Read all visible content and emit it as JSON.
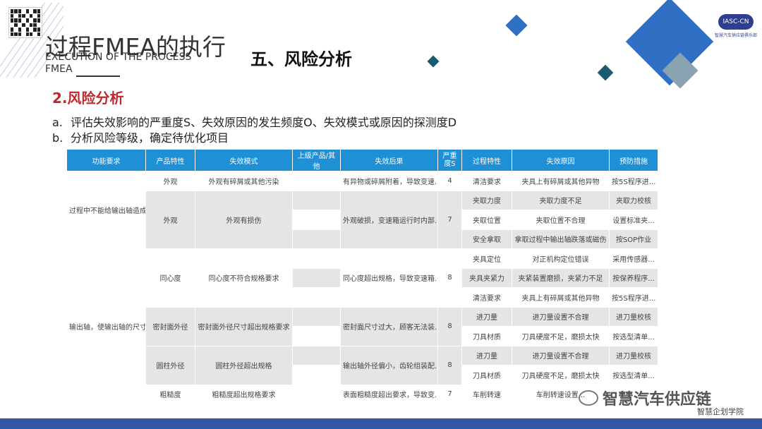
{
  "header": {
    "main_title": "过程FMEA的执行",
    "subtitle_en": "EXECUTION OF THE PROCESS FMEA",
    "section_title": "五、风险分析",
    "logo_text": "IASC-CN",
    "logo_sub": "智慧汽车供应链俱乐部"
  },
  "content": {
    "point_title": "2.风险分析",
    "items": [
      {
        "marker": "a.",
        "text": "评估失效影响的严重度S、失效原因的发生频度O、失效模式或原因的探测度D"
      },
      {
        "marker": "b.",
        "text": "分析风险等级，确定待优化项目"
      }
    ]
  },
  "table": {
    "headers": [
      "功能要求",
      "产品特性",
      "失效模式",
      "上级产品/其他",
      "失效后果",
      "严重度S",
      "过程特性",
      "失效原因",
      "预防措施"
    ],
    "function_groups": [
      "过程中不能给输出轴造成...",
      "输出轴，使输出轴的尺寸..."
    ],
    "characteristics": [
      "外观",
      "外观",
      "同心度",
      "密封面外径",
      "圆柱外径",
      "粗糙度"
    ],
    "failure_modes": [
      "外观有碎屑或其他污染",
      "外观有损伤",
      "同心度不符合规格要求",
      "密封面外径尺寸超出规格要求",
      "圆柱外径超出规格",
      "粗糙度超出规格要求"
    ],
    "effects": [
      "有异物或碎屑附着，导致变速...",
      "外观破损，变速箱运行时内部...",
      "同心度超出规格，导致变速箱...",
      "密封面尺寸过大，顾客无法装...",
      "输出轴外径偏小，齿轮组装配...",
      "表面粗糙度超出要求，导致变..."
    ],
    "severities": [
      "4",
      "7",
      "8",
      "8",
      "8",
      "7"
    ],
    "process_chars": [
      "清洁要求",
      "夹取力度",
      "夹取位置",
      "安全拿取",
      "夹具定位",
      "夹具夹紧力",
      "清洁要求",
      "进刀量",
      "刀具材质",
      "进刀量",
      "刀具材质",
      "车削转速"
    ],
    "causes": [
      "夹具上有碎屑或其他异物",
      "夹取力度不足",
      "夹取位置不合理",
      "拿取过程中输出轴跌落或磁伤",
      "对正机构定位错误",
      "夹紧装置磨损，夹紧力不足",
      "夹具上有碎屑或其他异物",
      "进刀量设置不合理",
      "刀具硬度不足，磨损太快",
      "进刀量设置不合理",
      "刀具硬度不足，磨损太快",
      "车削转速设置..."
    ],
    "prevention": [
      "按5S程序进...",
      "夹取力校核",
      "设置标准夹...",
      "按SOP作业",
      "采用传感器...",
      "按保养程序...",
      "按5S程序进...",
      "进刀量校核",
      "按选型清单...",
      "进刀量校核",
      "按选型清单...",
      ""
    ]
  },
  "watermark": {
    "text": "智慧汽车供应链",
    "sub": "智慧企划学院"
  },
  "colors": {
    "accent_red": "#c0282e",
    "table_header": "#1f8fd6",
    "bottom_bar": "#3356a6",
    "diamond_blue": "#2f6fc4",
    "diamond_teal": "#1b5b6e",
    "diamond_grey": "#8aa3b0"
  }
}
